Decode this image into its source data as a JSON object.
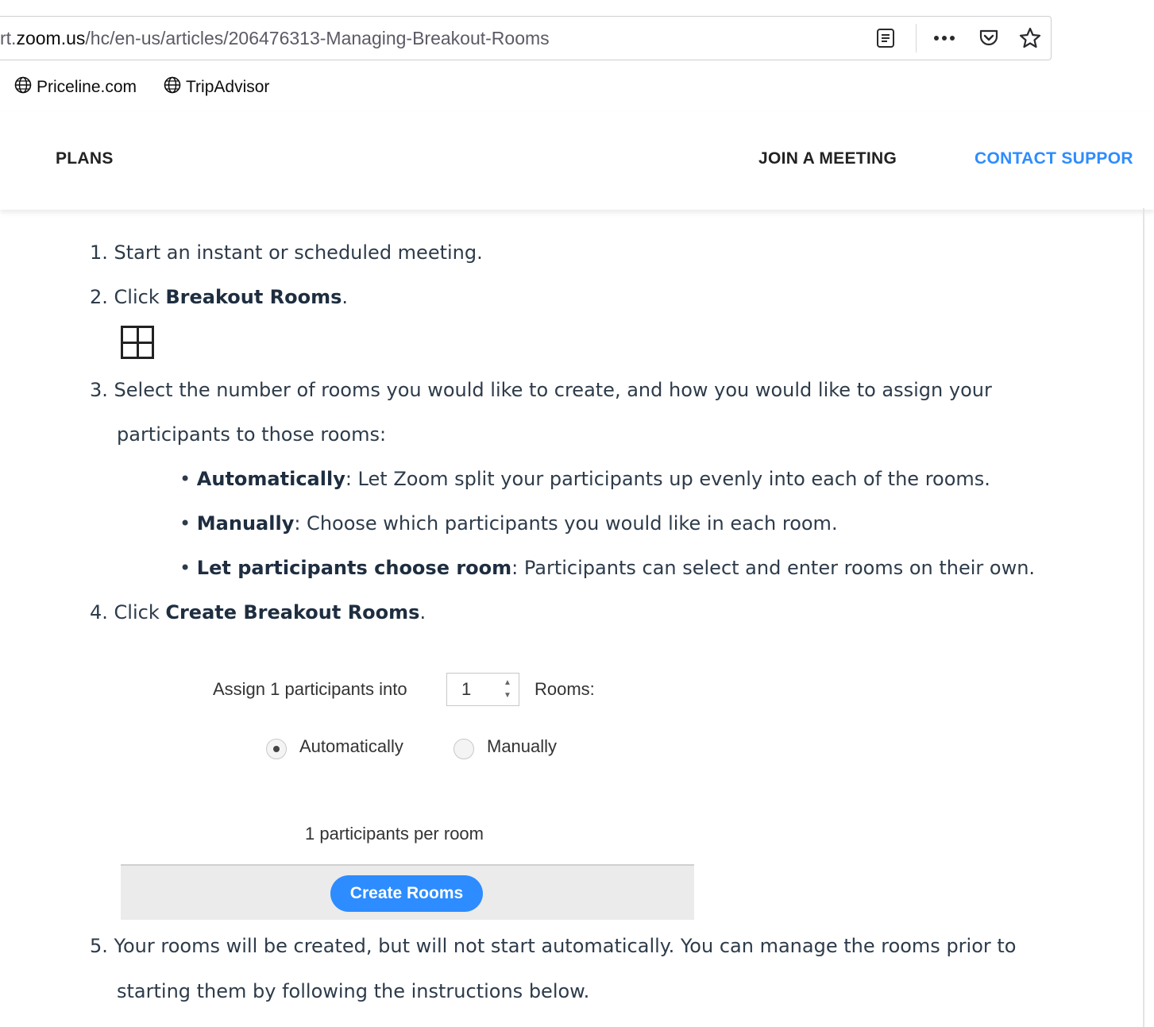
{
  "browser": {
    "url_prefix": "rt.",
    "url_domain": "zoom.us",
    "url_path": "/hc/en-us/articles/206476313-Managing-Breakout-Rooms",
    "reader_icon": "reader-view-icon",
    "more_icon": "more-actions-icon",
    "pocket_icon": "pocket-icon",
    "bookmark_star_icon": "bookmark-star-icon",
    "bookmarks": [
      {
        "label": "Priceline.com",
        "icon": "globe-icon"
      },
      {
        "label": "TripAdvisor",
        "icon": "globe-icon"
      }
    ]
  },
  "nav": {
    "plans": "PLANS",
    "join": "JOIN A MEETING",
    "contact": "CONTACT SUPPOR",
    "contact_color": "#2d8cff"
  },
  "article": {
    "step1": "1. Start an instant or scheduled meeting.",
    "step2_pre": "2. Click ",
    "step2_bold": "Breakout Rooms",
    "step2_post": ".",
    "step2_icon": "breakout-rooms-grid-icon",
    "step3_line1": "3. Select the number of rooms you would like to create, and how you would like to assign your",
    "step3_line2": "participants to those rooms:",
    "bullets": [
      {
        "bold": "Automatically",
        "text": ": Let Zoom split your participants up evenly into each of the rooms."
      },
      {
        "bold": "Manually",
        "text": ": Choose which participants you would like in each room."
      },
      {
        "bold": "Let participants choose room",
        "text": ": Participants can select and enter rooms on their own."
      }
    ],
    "step4_pre": "4. Click ",
    "step4_bold": "Create Breakout Rooms",
    "step4_post": ".",
    "step5_line1": "5. Your rooms will be created, but will not start automatically. You can manage the rooms prior to",
    "step5_line2": "starting them by following the instructions below."
  },
  "dialog": {
    "assign_label": "Assign 1 participants into",
    "rooms_count": "1",
    "rooms_label": "Rooms:",
    "option_auto": "Automatically",
    "option_manual": "Manually",
    "selected_option": "Automatically",
    "per_room": "1 participants per room",
    "create_button": "Create Rooms",
    "button_color": "#2d8cff"
  }
}
